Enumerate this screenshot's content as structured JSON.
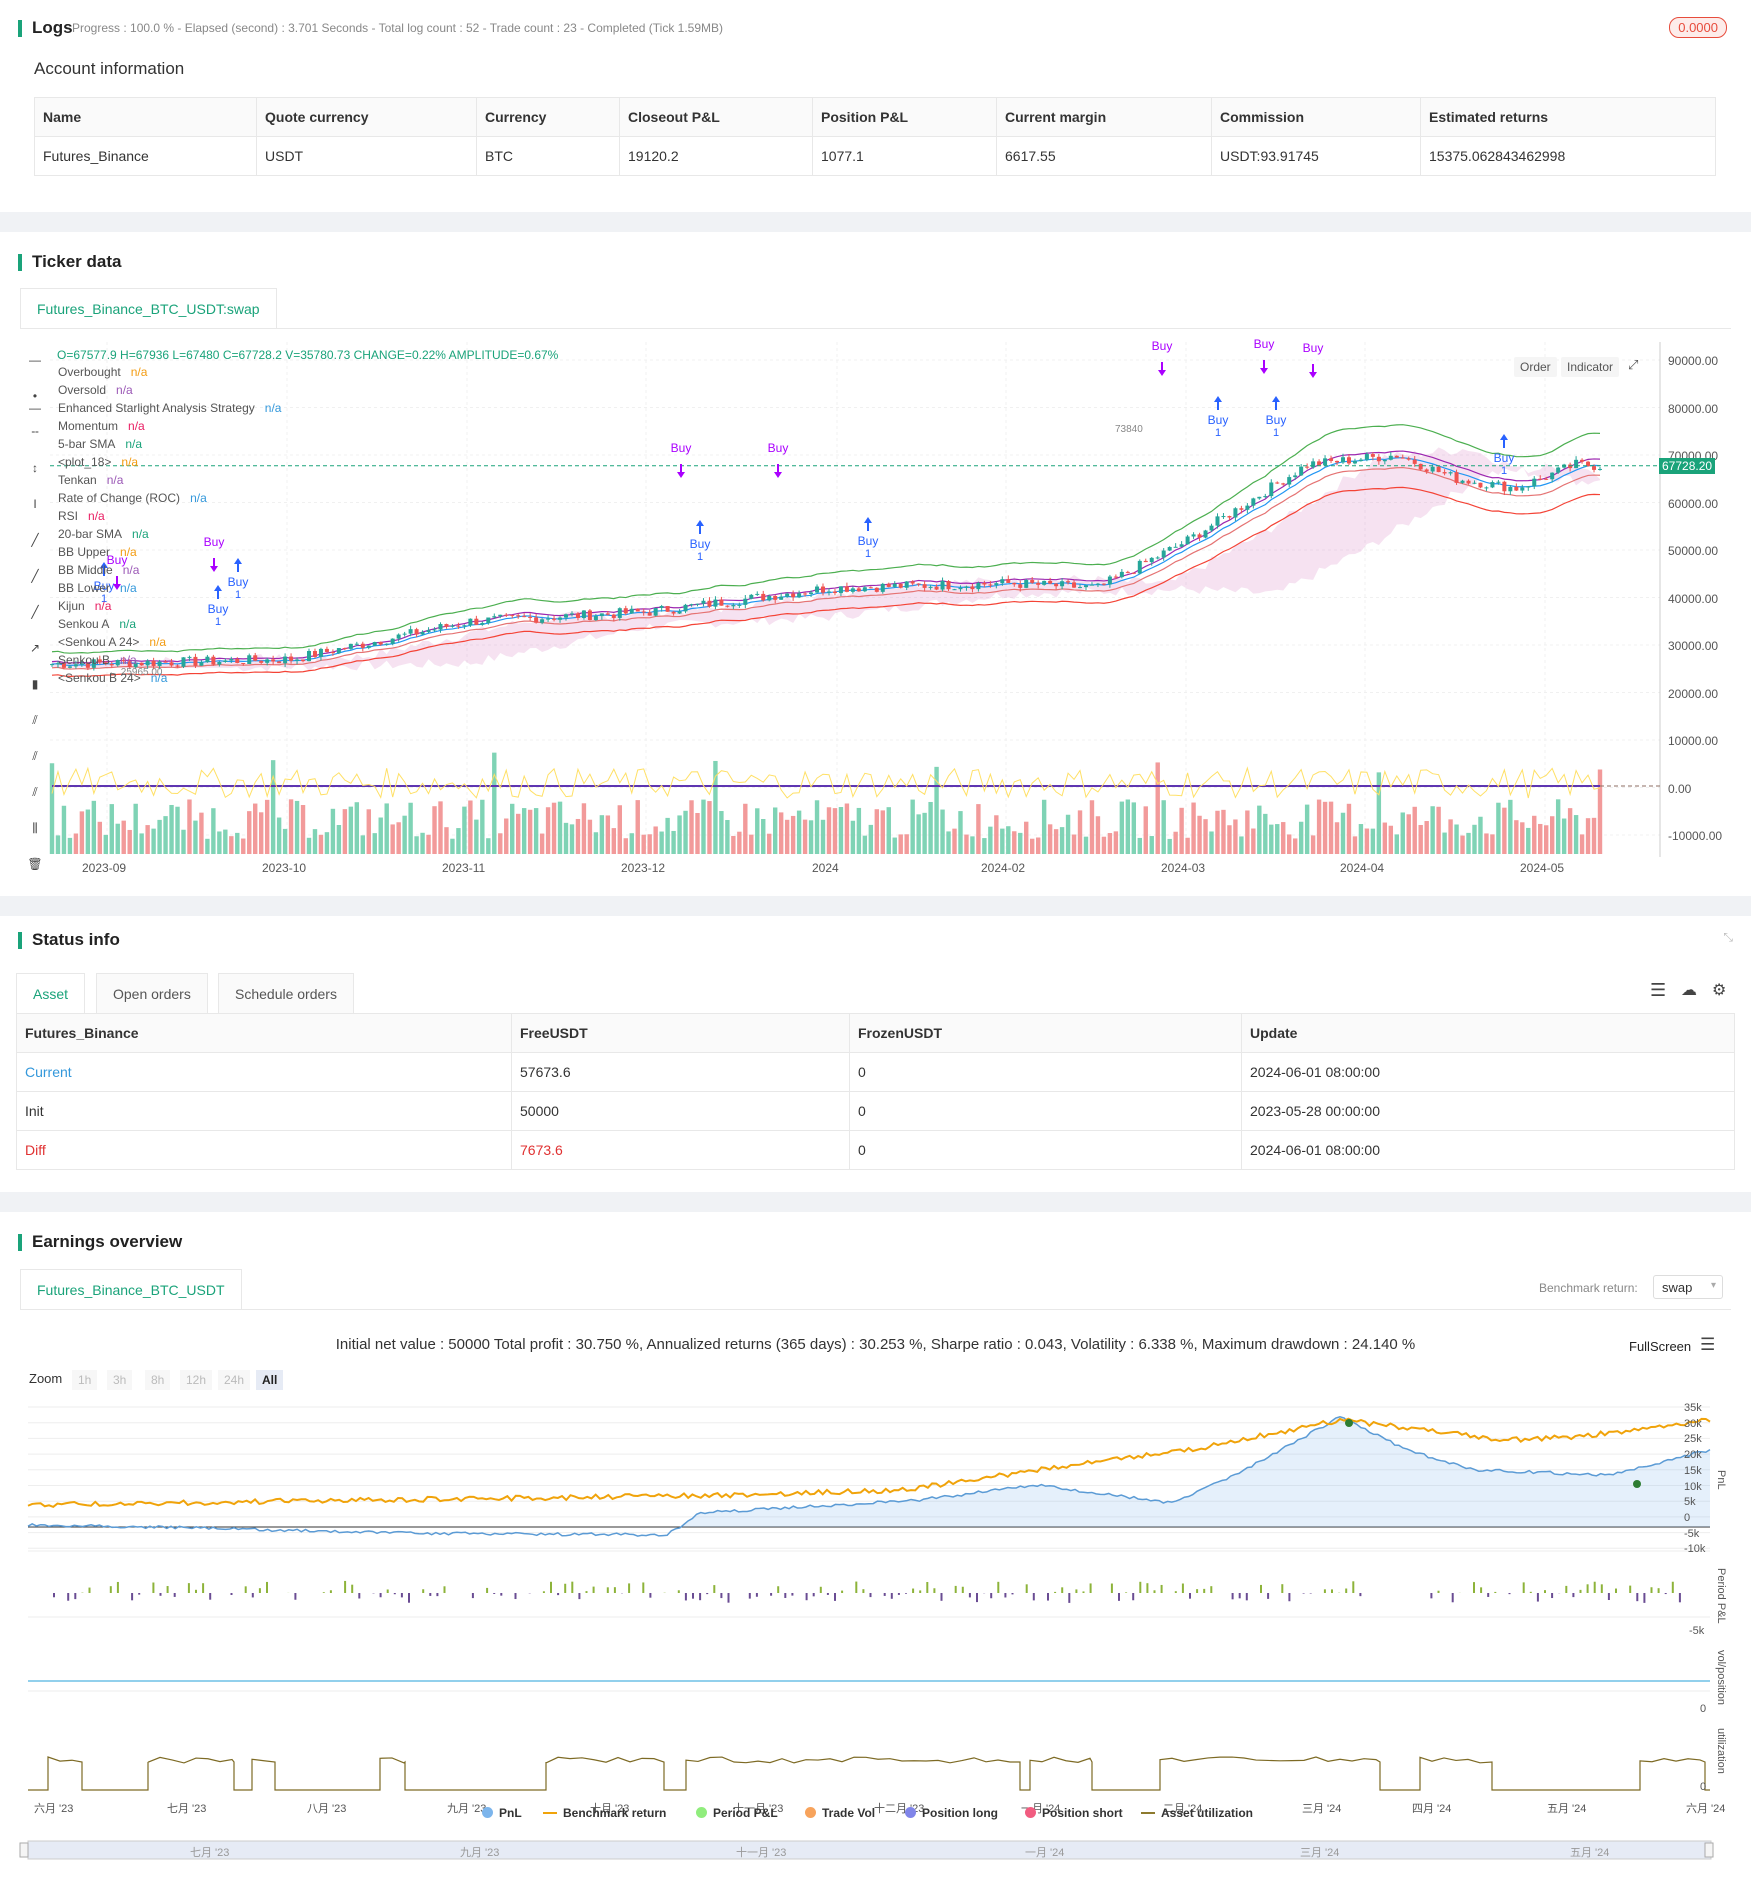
{
  "logs": {
    "title": "Logs",
    "progress": "Progress : 100.0 % - Elapsed (second) : 3.701  Seconds - Total log count : 52 - Trade count : 23 - Completed (Tick 1.59MB)",
    "badge": "0.0000"
  },
  "account": {
    "title": "Account information",
    "headers": [
      "Name",
      "Quote currency",
      "Currency",
      "Closeout P&L",
      "Position P&L",
      "Current margin",
      "Commission",
      "Estimated returns"
    ],
    "row": [
      "Futures_Binance",
      "USDT",
      "BTC",
      "19120.2",
      "1077.1",
      "6617.55",
      "USDT:93.91745",
      "15375.062843462998"
    ]
  },
  "ticker": {
    "title": "Ticker data",
    "tab": "Futures_Binance_BTC_USDT:swap",
    "ohlc": "O=67577.9 H=67936 L=67480 C=67728.2 V=35780.73 CHANGE=0.22% AMPLITUDE=0.67%",
    "buttons": [
      "Order",
      "Indicator"
    ],
    "legend": [
      {
        "name": "Overbought",
        "value": "n/a",
        "color": "#f39c12"
      },
      {
        "name": "Oversold",
        "value": "n/a",
        "color": "#9b59b6"
      },
      {
        "name": "Enhanced Starlight Analysis Strategy",
        "value": "n/a",
        "color": "#3498db"
      },
      {
        "name": "Momentum",
        "value": "n/a",
        "color": "#e91e63"
      },
      {
        "name": "5-bar SMA",
        "value": "n/a",
        "color": "#1aa37a"
      },
      {
        "name": "<plot_18>",
        "value": "n/a",
        "color": "#f39c12"
      },
      {
        "name": "Tenkan",
        "value": "n/a",
        "color": "#9b59b6"
      },
      {
        "name": "Rate of Change (ROC)",
        "value": "n/a",
        "color": "#3498db"
      },
      {
        "name": "RSI",
        "value": "n/a",
        "color": "#e91e63"
      },
      {
        "name": "20-bar SMA",
        "value": "n/a",
        "color": "#1aa37a"
      },
      {
        "name": "BB Upper",
        "value": "n/a",
        "color": "#f39c12"
      },
      {
        "name": "BB Middle",
        "value": "n/a",
        "color": "#9b59b6"
      },
      {
        "name": "BB Lower",
        "value": "n/a",
        "color": "#3498db"
      },
      {
        "name": "Kijun",
        "value": "n/a",
        "color": "#e91e63"
      },
      {
        "name": "Senkou A",
        "value": "n/a",
        "color": "#1aa37a"
      },
      {
        "name": "<Senkou A 24>",
        "value": "n/a",
        "color": "#f39c12"
      },
      {
        "name": "Senkou B",
        "value": "n/a",
        "color": "#9b59b6"
      },
      {
        "name": "<Senkou B 24>",
        "value": "n/a",
        "color": "#3498db"
      }
    ],
    "price_ticks": [
      "90000.00",
      "80000.00",
      "70000.00",
      "60000.00",
      "50000.00",
      "40000.00",
      "30000.00",
      "20000.00",
      "10000.00",
      "0.00",
      "-10000.00"
    ],
    "last_price": "67728.20",
    "x_ticks": [
      "2023-09",
      "2023-10",
      "2023-11",
      "2023-12",
      "2024",
      "2024-02",
      "2024-03",
      "2024-04",
      "2024-05"
    ],
    "signal_label": "Buy",
    "signal_qty": "1",
    "low_label": "25965.00",
    "high_label": "73840"
  },
  "status": {
    "title": "Status info",
    "tabs": [
      "Asset",
      "Open orders",
      "Schedule orders"
    ],
    "headers": [
      "Futures_Binance",
      "FreeUSDT",
      "FrozenUSDT",
      "Update"
    ],
    "rows": [
      [
        "Current",
        "57673.6",
        "0",
        "2024-06-01 08:00:00"
      ],
      [
        "Init",
        "50000",
        "0",
        "2023-05-28 00:00:00"
      ],
      [
        "Diff",
        "7673.6",
        "0",
        "2024-06-01 08:00:00"
      ]
    ]
  },
  "earnings": {
    "title": "Earnings overview",
    "tab": "Futures_Binance_BTC_USDT",
    "benchmark_label": "Benchmark return:",
    "benchmark_value": "swap",
    "summary": "Initial net value : 50000 Total profit : 30.750 %, Annualized returns (365 days) : 30.253 %, Sharpe ratio : 0.043, Volatility : 6.338 %, Maximum drawdown : 24.140 %",
    "fullscreen": "FullScreen",
    "zoom_label": "Zoom",
    "zoom_options": [
      "1h",
      "3h",
      "8h",
      "12h",
      "24h",
      "All"
    ],
    "pnl_ticks": [
      "35k",
      "30k",
      "25k",
      "20k",
      "15k",
      "10k",
      "5k",
      "0",
      "-5k",
      "-10k"
    ],
    "period_ticks": [
      "-5k"
    ],
    "pos_ticks": [
      "0"
    ],
    "util_ticks": [
      "0"
    ],
    "side_labels": [
      "PnL",
      "Period P&L",
      "vol/position",
      "utilization"
    ],
    "x_ticks": [
      "六月 '23",
      "七月 '23",
      "八月 '23",
      "九月 '23",
      "十月 '23",
      "十一月 '23",
      "十二月 '23",
      "一月 '24",
      "二月 '24",
      "三月 '24",
      "四月 '24",
      "五月 '24",
      "六月 '24"
    ],
    "nav_ticks": [
      "七月 '23",
      "九月 '23",
      "十一月 '23",
      "一月 '24",
      "三月 '24",
      "五月 '24"
    ],
    "legend": [
      {
        "name": "PnL",
        "color": "#7cb5ec"
      },
      {
        "name": "Benchmark return",
        "color": "#f0a30a"
      },
      {
        "name": "Period P&L",
        "color": "#90ed7d"
      },
      {
        "name": "Trade Vol",
        "color": "#f7a35c"
      },
      {
        "name": "Position long",
        "color": "#8085e9"
      },
      {
        "name": "Position short",
        "color": "#f15c80"
      },
      {
        "name": "Asset utilization",
        "color": "#8d7a2e"
      }
    ]
  }
}
